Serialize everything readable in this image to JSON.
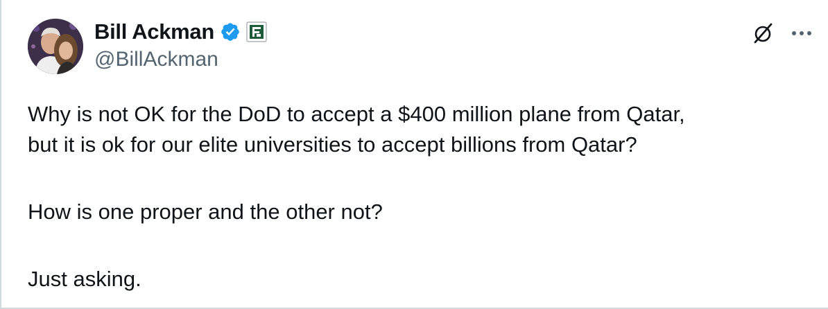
{
  "author": {
    "display_name": "Bill Ackman",
    "handle": "@BillAckman",
    "verified": true,
    "avatar": "avatar-photo",
    "affiliation_icon": "affiliation-badge-icon"
  },
  "actions": {
    "grok_icon": "grok-icon",
    "more_icon": "more-dots-icon"
  },
  "tweet": {
    "paragraph_1_line_1": "Why is not OK for the DoD to accept a $400 million plane from Qatar,",
    "paragraph_1_line_2": "but it is ok for our elite universities to accept billions from Qatar?",
    "paragraph_2": "How is one proper and the other not?",
    "paragraph_3": "Just asking."
  },
  "colors": {
    "text_primary": "#0f1419",
    "text_secondary": "#536471",
    "verified_blue": "#1d9bf0",
    "affiliation_green": "#1e5b3a",
    "border": "#cfd9de"
  }
}
